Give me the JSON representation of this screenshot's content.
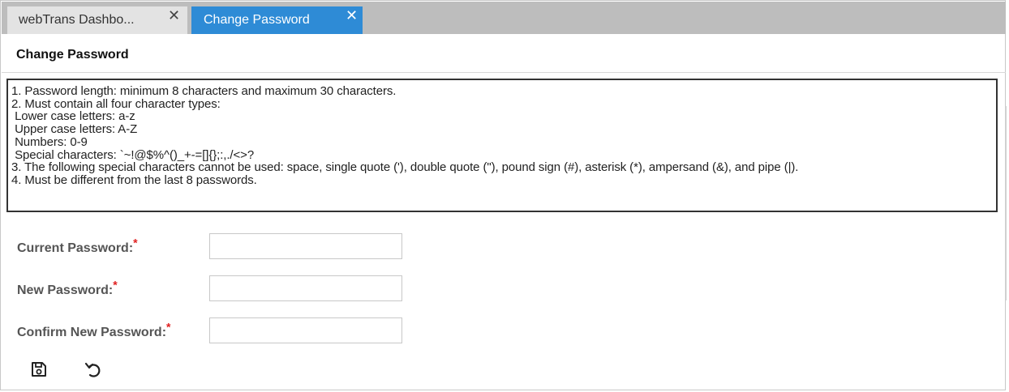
{
  "tabs": [
    {
      "label": "webTrans Dashbo...",
      "close": "✕",
      "active": false
    },
    {
      "label": "Change Password",
      "close": "✕",
      "active": true
    }
  ],
  "page": {
    "title": "Change Password"
  },
  "rules": [
    "1. Password length: minimum 8 characters and maximum 30 characters.",
    "2. Must contain all four character types:",
    " Lower case letters: a-z",
    " Upper case letters: A-Z",
    " Numbers: 0-9",
    " Special characters: `~!@$%^()_+-=[]{};:,./<>?",
    "3. The following special characters cannot be used: space, single quote ('), double quote (\"), pound sign (#), asterisk (*), ampersand (&), and pipe (|).",
    "4. Must be different from the last 8 passwords."
  ],
  "form": {
    "required_mark": "*",
    "current_password": {
      "label": "Current Password:",
      "value": ""
    },
    "new_password": {
      "label": "New Password:",
      "value": ""
    },
    "confirm_password": {
      "label": "Confirm New Password:",
      "value": ""
    }
  },
  "toolbar": {
    "save_icon": "save-icon",
    "reset_icon": "undo-icon"
  },
  "colors": {
    "active_tab": "#2e8bd6",
    "tabbar": "#bdbdbd",
    "required": "#e02020"
  }
}
